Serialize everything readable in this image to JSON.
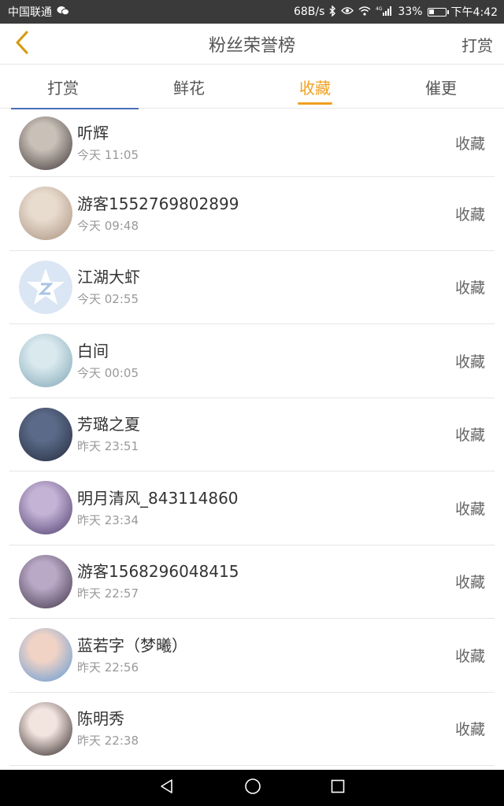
{
  "status_bar": {
    "carrier": "中国联通",
    "speed": "68B/s",
    "signal_label": "4G",
    "battery_percent": "33%",
    "battery_level": 0.33,
    "time": "下午4:42"
  },
  "header": {
    "title": "粉丝荣誉榜",
    "action_label": "打赏"
  },
  "tabs": [
    {
      "label": "打赏"
    },
    {
      "label": "鲜花"
    },
    {
      "label": "收藏"
    },
    {
      "label": "催更"
    }
  ],
  "active_tab": "收藏",
  "list": [
    {
      "name": "听辉",
      "time": "今天 11:05",
      "action": "收藏",
      "avatar_colors": [
        "#c9c0b8",
        "#3c3434"
      ]
    },
    {
      "name": "游客1552769802899",
      "time": "今天 09:48",
      "action": "收藏",
      "avatar_colors": [
        "#e8dccf",
        "#a88f7c"
      ]
    },
    {
      "name": "江湖大虾",
      "time": "今天 02:55",
      "action": "收藏",
      "avatar_colors": [
        "#dbe6f4",
        "#a9c4e4"
      ]
    },
    {
      "name": "白间",
      "time": "今天 00:05",
      "action": "收藏",
      "avatar_colors": [
        "#d9e9ee",
        "#7ea4b3"
      ]
    },
    {
      "name": "芳璐之夏",
      "time": "昨天 23:51",
      "action": "收藏",
      "avatar_colors": [
        "#5b6a88",
        "#242c3e"
      ]
    },
    {
      "name": "明月清风_843114860",
      "time": "昨天 23:34",
      "action": "收藏",
      "avatar_colors": [
        "#c5b3d6",
        "#4a3b6a"
      ]
    },
    {
      "name": "游客1568296048415",
      "time": "昨天 22:57",
      "action": "收藏",
      "avatar_colors": [
        "#b9a8c6",
        "#3d3345"
      ]
    },
    {
      "name": "蓝若字（梦曦）",
      "time": "昨天 22:56",
      "action": "收藏",
      "avatar_colors": [
        "#f1d3c6",
        "#5c98d6"
      ]
    },
    {
      "name": "陈明秀",
      "time": "昨天 22:38",
      "action": "收藏",
      "avatar_colors": [
        "#f2e4df",
        "#2b2222"
      ]
    }
  ],
  "colors": {
    "accent": "#f0a020",
    "status_bar_bg": "#3a3a3a",
    "nav_bar_bg": "#000000"
  }
}
